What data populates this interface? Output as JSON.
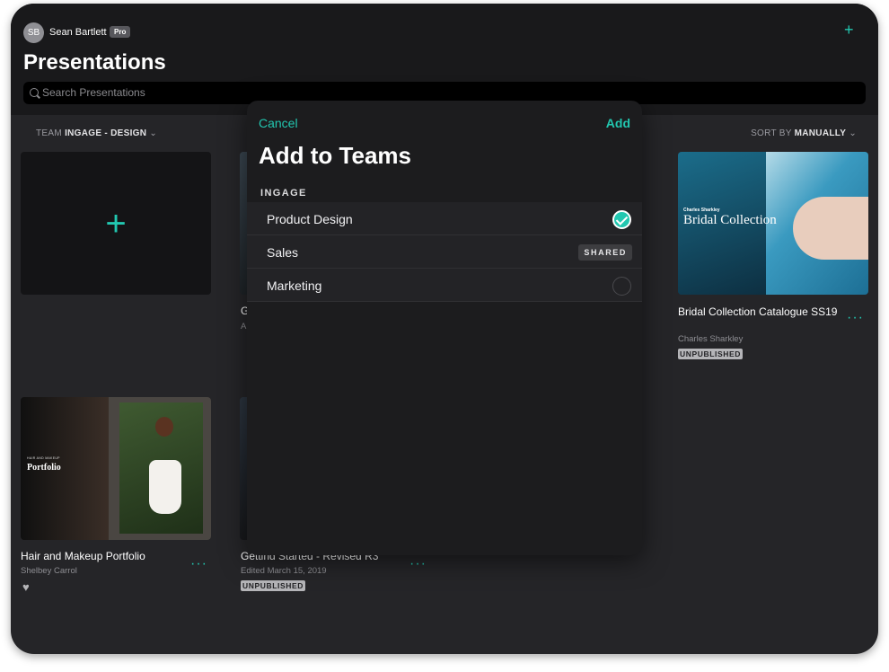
{
  "header": {
    "avatar_initials": "SB",
    "user_name": "Sean Bartlett",
    "plan_badge": "Pro",
    "title": "Presentations",
    "search_placeholder": "Search Presentations"
  },
  "filters": {
    "team_label": "TEAM",
    "team_value": "INGAGE - DESIGN",
    "sort_label": "SORT BY",
    "sort_value": "MANUALLY"
  },
  "cards": [
    {
      "title": "Bridal Collection Catalogue SS19",
      "author": "Charles Sharkley",
      "status": "UNPUBLISHED",
      "thumb_author": "Charles Sharkley",
      "thumb_title": "Bridal Collection"
    },
    {
      "title": "Hair and Makeup Portfolio",
      "author": "Shelbey Carrol",
      "thumb_small": "HAIR AND MAKEUP",
      "thumb_title": "Portfolio"
    },
    {
      "title": "Getting Started - Revised R3",
      "edited": "Edited March 15, 2019",
      "status": "UNPUBLISHED"
    }
  ],
  "partial_labels": {
    "card2_title_fragment": "G",
    "card2_sub_fragment": "A"
  },
  "modal": {
    "cancel": "Cancel",
    "add": "Add",
    "title": "Add to Teams",
    "section": "INGAGE",
    "rows": [
      {
        "label": "Product Design",
        "state": "checked"
      },
      {
        "label": "Sales",
        "state": "shared",
        "badge": "SHARED"
      },
      {
        "label": "Marketing",
        "state": "unchecked"
      }
    ]
  },
  "colors": {
    "accent": "#22c7b0",
    "background": "#252528",
    "header": "#19191b",
    "modal": "#1c1c1e"
  },
  "icons": {
    "add": "plus-icon",
    "search": "search-icon",
    "more": "ellipsis-icon",
    "favorite": "heart-icon",
    "chevron": "chevron-down-icon",
    "check": "checkmark-icon"
  }
}
